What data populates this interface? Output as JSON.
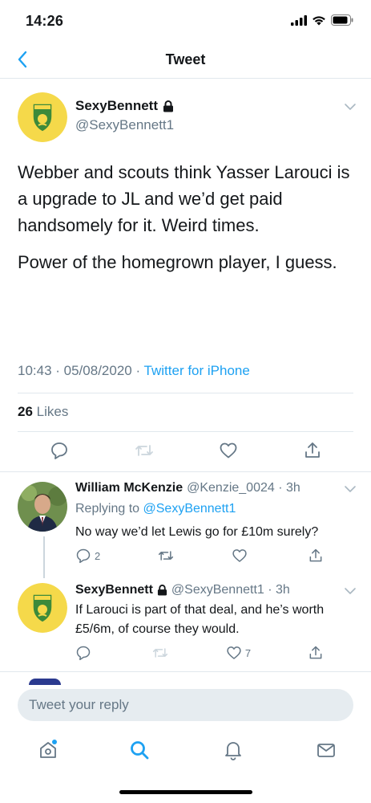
{
  "status_bar": {
    "time": "14:26"
  },
  "nav": {
    "title": "Tweet"
  },
  "main_tweet": {
    "display_name": "SexyBennett",
    "handle": "@SexyBennett1",
    "paragraphs": [
      "Webber and scouts think Yasser Larouci is a upgrade to JL and we’d get paid handsomely for it. Weird times.",
      "Power of the homegrown player, I guess."
    ],
    "timestamp": "10:43 · 05/08/2020 ·",
    "source": "Twitter for iPhone",
    "likes_count": "26",
    "likes_label": "Likes"
  },
  "replies": [
    {
      "display_name": "William McKenzie",
      "handle": "@Kenzie_0024 · 3h",
      "replying_prefix": "Replying to",
      "replying_handle": "@SexyBennett1",
      "text": "No way we’d let Lewis go for £10m surely?",
      "reply_count": "2",
      "like_count": ""
    },
    {
      "display_name": "SexyBennett",
      "handle": "@SexyBennett1 · 3h",
      "text": "If Larouci is part of that deal, and he’s worth £5/6m, of course they would.",
      "reply_count": "",
      "like_count": "7"
    }
  ],
  "composer": {
    "placeholder": "Tweet your reply"
  },
  "colors": {
    "accent": "#1da1f2",
    "secondary_text": "#657786",
    "badge_yellow": "#f5d94a",
    "badge_green": "#3c8a3a"
  }
}
